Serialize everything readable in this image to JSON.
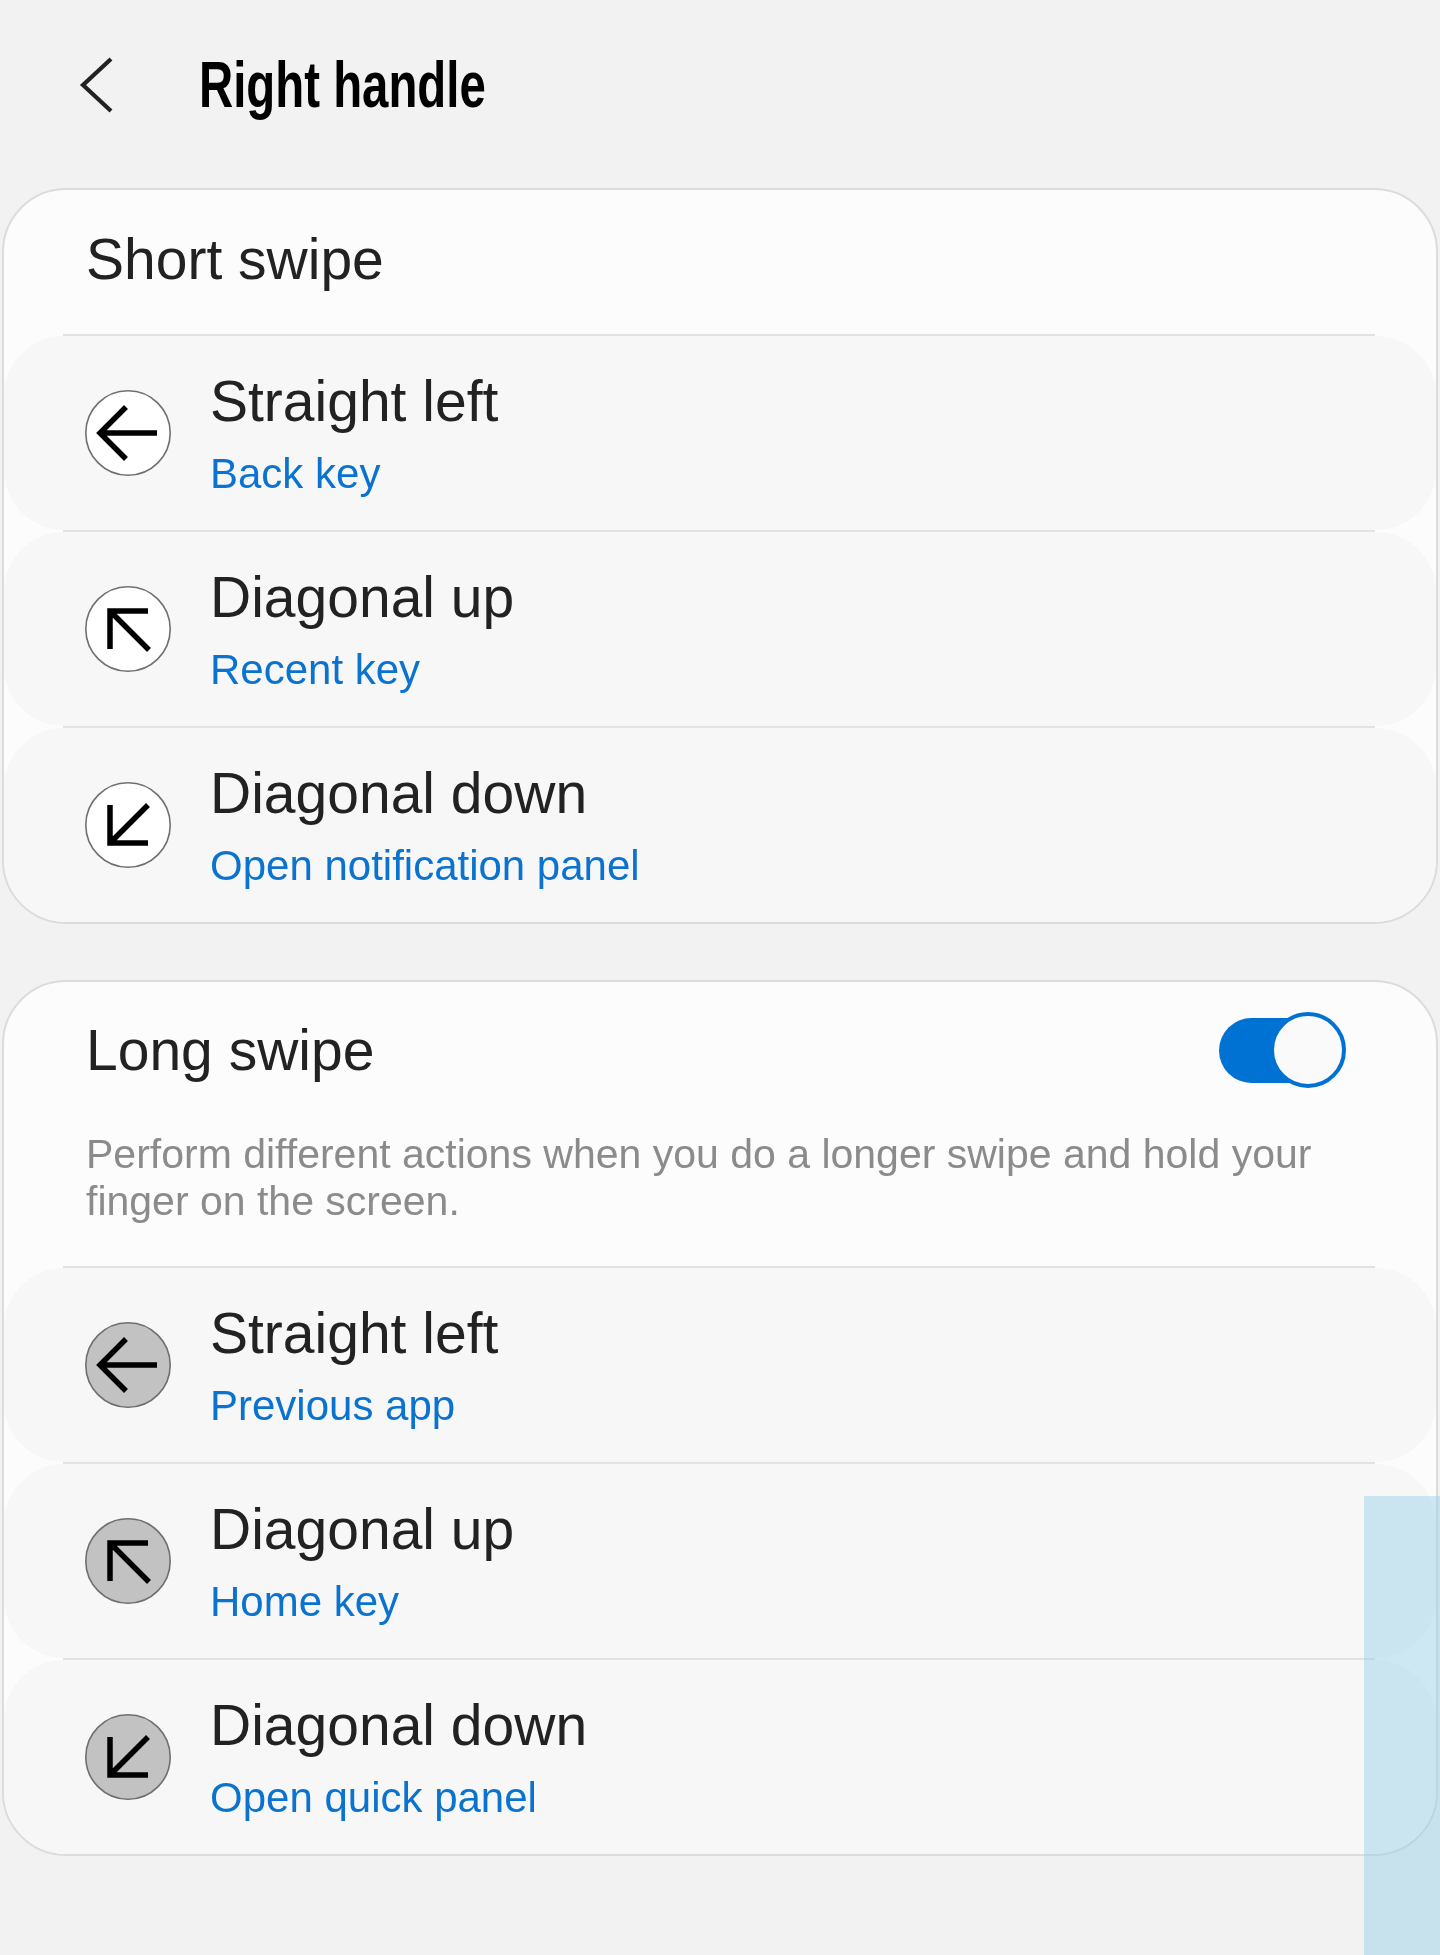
{
  "header": {
    "title": "Right handle"
  },
  "sections": [
    {
      "kind": "short",
      "title": "Short swipe",
      "items": [
        {
          "kind": "left",
          "title": "Straight left",
          "action": "Back key"
        },
        {
          "kind": "up-left",
          "title": "Diagonal up",
          "action": "Recent key"
        },
        {
          "kind": "down-left",
          "title": "Diagonal down",
          "action": "Open notification panel"
        }
      ]
    },
    {
      "kind": "long",
      "title": "Long swipe",
      "switch": {
        "on": true
      },
      "description": "Perform different actions when you do a longer swipe and hold your finger on the screen.",
      "items": [
        {
          "kind": "left",
          "title": "Straight left",
          "action": "Previous app"
        },
        {
          "kind": "up-left",
          "title": "Diagonal up",
          "action": "Home key"
        },
        {
          "kind": "down-left",
          "title": "Diagonal down",
          "action": "Open quick panel"
        }
      ]
    }
  ]
}
